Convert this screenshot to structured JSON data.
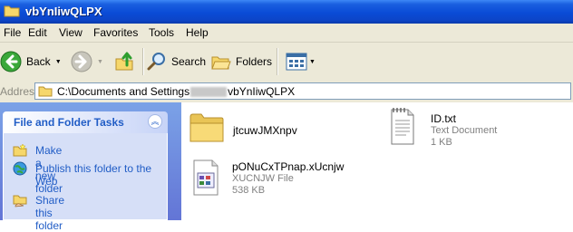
{
  "window": {
    "title": "vbYnIiwQLPX"
  },
  "menu": [
    "File",
    "Edit",
    "View",
    "Favorites",
    "Tools",
    "Help"
  ],
  "toolbar": {
    "back_label": "Back",
    "search_label": "Search",
    "folders_label": "Folders"
  },
  "address": {
    "label": "Address",
    "path_prefix": "C:\\Documents and Settings",
    "path_suffix": "vbYnIiwQLPX"
  },
  "tasks": {
    "title": "File and Folder Tasks",
    "items": [
      {
        "label": "Make a new folder",
        "icon": "new-folder-icon"
      },
      {
        "label": "Publish this folder to the Web",
        "icon": "publish-web-icon"
      },
      {
        "label": "Share this folder",
        "icon": "share-folder-icon"
      }
    ]
  },
  "files": [
    {
      "name": "jtcuwJMXnpv",
      "type": "",
      "size": ""
    },
    {
      "name": "ID.txt",
      "type": "Text Document",
      "size": "1 KB"
    },
    {
      "name": "pONuCxTPnap.xUcnjw",
      "type": "XUCNJW File",
      "size": "538 KB"
    }
  ]
}
